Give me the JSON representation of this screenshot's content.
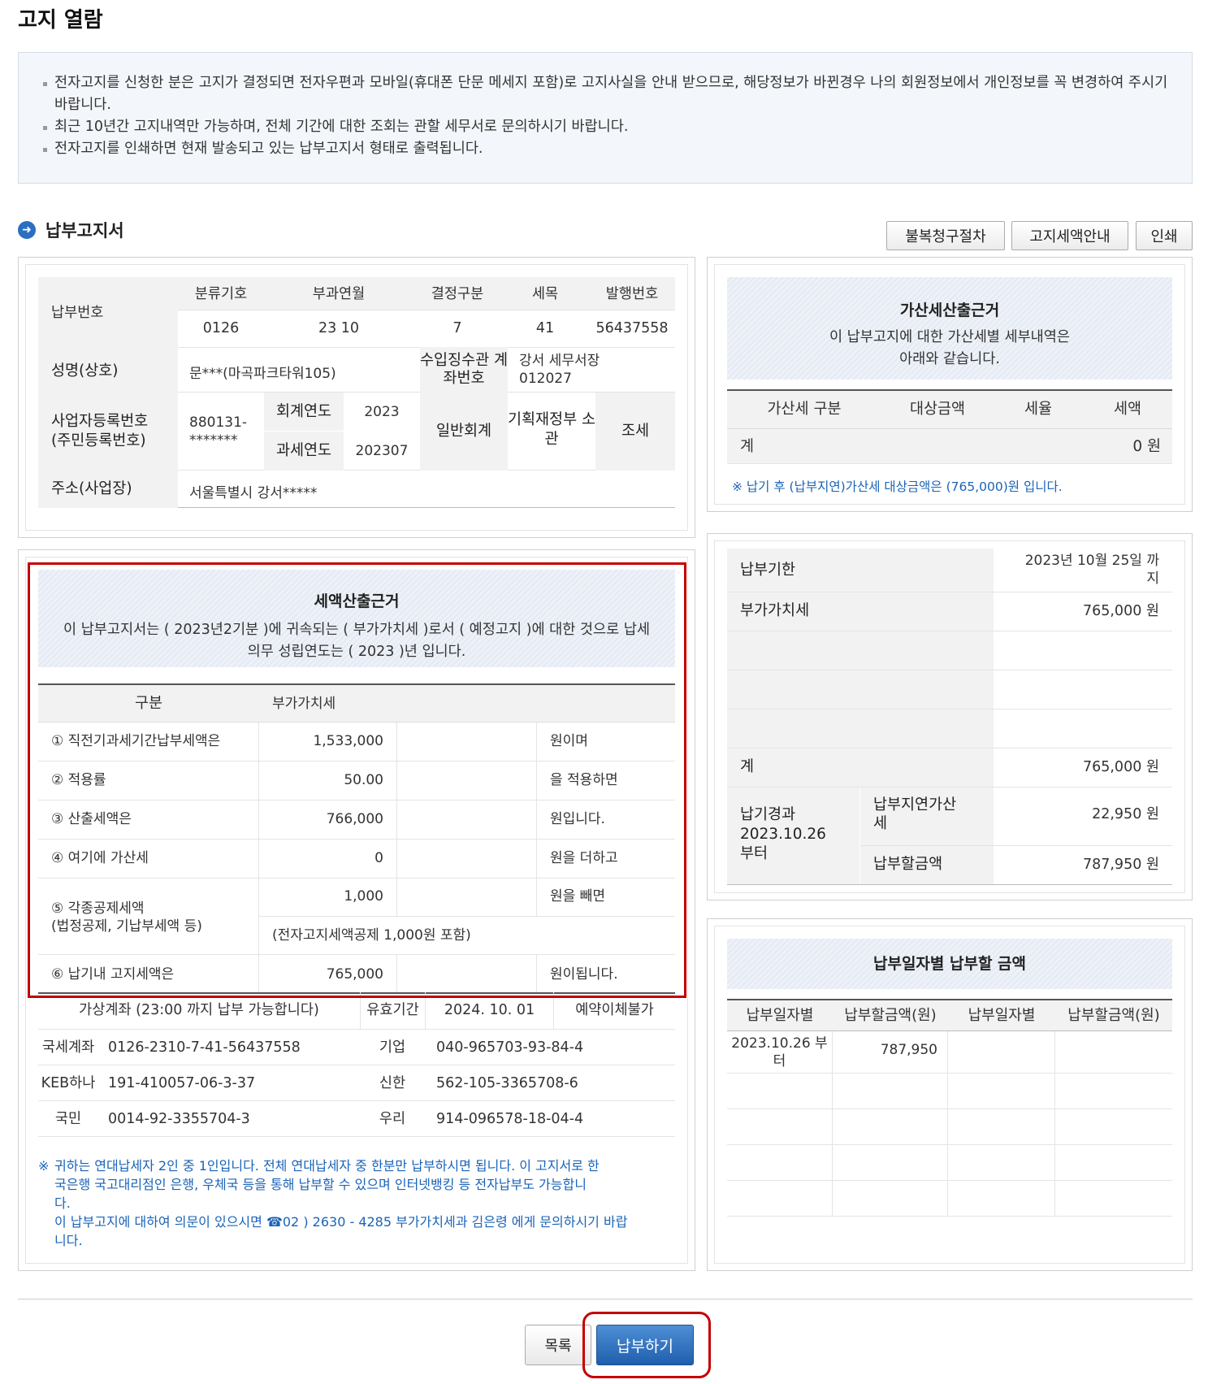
{
  "page_title": "고지 열람",
  "notice": [
    "전자고지를 신청한 분은 고지가 결정되면 전자우편과 모바일(휴대폰 단문 메세지 포함)로 고지사실을 안내 받으므로, 해당정보가 바뀐경우 나의 회원정보에서 개인정보를 꼭 변경하여 주시기 바랍니다.",
    "최근 10년간 고지내역만 가능하며, 전체 기간에 대한 조회는 관할 세무서로 문의하시기 바랍니다.",
    "전자고지를 인쇄하면 현재 발송되고 있는 납부고지서 형태로 출력됩니다."
  ],
  "section_title": "납부고지서",
  "toolbar": {
    "objection": "불복청구절차",
    "tax_info": "고지세액안내",
    "print": "인쇄"
  },
  "info": {
    "pay_no_label": "납부번호",
    "headers": [
      "분류기호",
      "부과연월",
      "결정구분",
      "세목",
      "발행번호"
    ],
    "values": [
      "0126",
      "23 10",
      "7",
      "41",
      "56437558"
    ],
    "name_label": "성명(상호)",
    "name_value": "문***(마곡파크타워105)",
    "account_label": "수입징수관 계좌번호",
    "account_value_1": "강서 세무서장",
    "account_value_2": "012027",
    "biz_label_1": "사업자등록번호",
    "biz_label_2": "(주민등록번호)",
    "biz_value_1": "880131-",
    "biz_value_2": "*******",
    "fiscal_year_label": "회계연도",
    "fiscal_year": "2023",
    "tax_year_label": "과세연도",
    "tax_year": "202307",
    "general_account": "일반회계",
    "ministry": "기획재정부 소관",
    "tax_type": "조세",
    "address_label": "주소(사업장)",
    "address_value": "서울특별시 강서*****"
  },
  "basis": {
    "title": "세액산출근거",
    "desc_1": "이 납부고지서는 ( 2023년2기분 )에 귀속되는 ( 부가가치세 )로서 ( 예정고지 )에 대한 것으로 납세",
    "desc_2": "의무 성립연도는 ( 2023 )년 입니다.",
    "col_1": "구분",
    "col_2": "부가가치세",
    "rows": [
      {
        "label": "① 직전기과세기간납부세액은",
        "value": "1,533,000",
        "suffix": "원이며"
      },
      {
        "label": "② 적용률",
        "value": "50.00",
        "suffix": "을 적용하면"
      },
      {
        "label": "③ 산출세액은",
        "value": "766,000",
        "suffix": "원입니다."
      },
      {
        "label": "④ 여기에 가산세",
        "value": "0",
        "suffix": "원을 더하고"
      }
    ],
    "deduct_label_1": "⑤ 각종공제세액",
    "deduct_label_2": "(법정공제, 기납부세액 등)",
    "deduct_value": "1,000",
    "deduct_suffix": "원을 빼면",
    "deduct_note": "(전자고지세액공제 1,000원 포함)",
    "final_label": "⑥ 납기내 고지세액은",
    "final_value": "765,000",
    "final_suffix": "원이됩니다."
  },
  "virtual": {
    "header": "가상계좌 (23:00 까지 납부 가능합니다)",
    "valid_label": "유효기간",
    "valid_date": "2024. 10. 01",
    "no_auto": "예약이체불가",
    "rows": [
      {
        "b1": "국세계좌",
        "a1": "0126-2310-7-41-56437558",
        "b2": "기업",
        "a2": "040-965703-93-84-4"
      },
      {
        "b1": "KEB하나",
        "a1": "191-410057-06-3-37",
        "b2": "신한",
        "a2": "562-105-3365708-6"
      },
      {
        "b1": "국민",
        "a1": "0014-92-3355704-3",
        "b2": "우리",
        "a2": "914-096578-18-04-4"
      }
    ]
  },
  "footnote": {
    "mark": "※",
    "line1": "귀하는 연대납세자 2인 중 1인입니다. 전체 연대납세자 중 한분만 납부하시면 됩니다. 이 고지서로 한",
    "line2": "국은행 국고대리점인 은행, 우체국 등을 통해 납부할 수 있으며 인터넷뱅킹 등 전자납부도 가능합니",
    "line3": "다.",
    "line4": "이 납부고지에 대하여 의문이 있으시면 ☎02 ) 2630 - 4285 부가가치세과 김은령 에게 문의하시기 바랍",
    "line5": "니다."
  },
  "penalty": {
    "title": "가산세산출근거",
    "desc_1": "이 납부고지에 대한 가산세별 세부내역은",
    "desc_2": "아래와 같습니다.",
    "headers": [
      "가산세 구분",
      "대상금액",
      "세율",
      "세액"
    ],
    "total_label": "계",
    "total_value": "0 원",
    "note": "※ 납기 후 (납부지연)가산세 대상금액은 (765,000)원 입니다."
  },
  "due": {
    "deadline_label": "납부기한",
    "deadline_1": "2023년 10월 25일 까",
    "deadline_2": "지",
    "vat_label": "부가가치세",
    "vat_value": "765,000 원",
    "sum_label": "계",
    "sum_value": "765,000 원",
    "after_label_1": "납기경과",
    "after_label_2": "2023.10.26",
    "after_label_3": "부터",
    "late_label_1": "납부지연가산",
    "late_label_2": "세",
    "late_value": "22,950 원",
    "pay_label": "납부할금액",
    "pay_value": "787,950 원"
  },
  "by_date": {
    "title": "납부일자별 납부할 금액",
    "headers": [
      "납부일자별",
      "납부할금액(원)",
      "납부일자별",
      "납부할금액(원)"
    ],
    "date_1": "2023.10.26 부",
    "date_2": "터",
    "amount": "787,950"
  },
  "buttons": {
    "list": "목록",
    "pay": "납부하기"
  },
  "colors": {
    "accent_blue": "#1f5fad",
    "highlight_red": "#c40000",
    "link_blue": "#1a63b8"
  }
}
